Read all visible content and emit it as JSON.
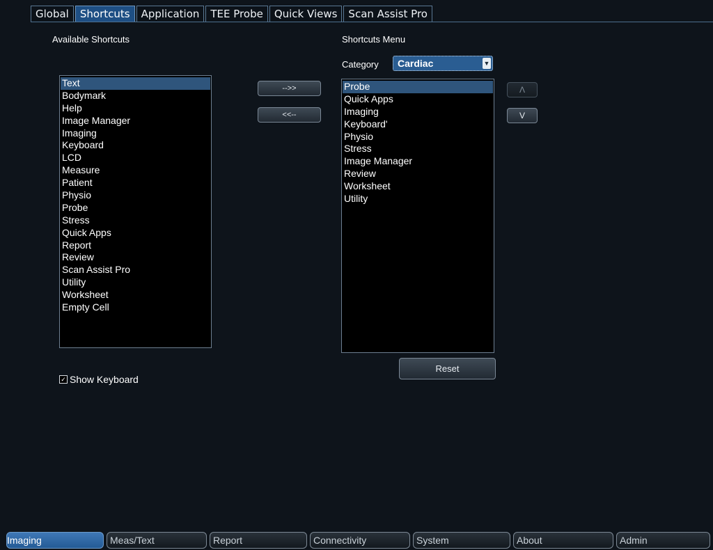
{
  "tabs": [
    "Global",
    "Shortcuts",
    "Application",
    "TEE Probe",
    "Quick Views",
    "Scan Assist Pro"
  ],
  "available": {
    "title": "Available Shortcuts",
    "items": [
      "Text",
      "Bodymark",
      "Help",
      "Image Manager",
      "Imaging",
      "Keyboard",
      "LCD",
      "Measure",
      "Patient",
      "Physio",
      "Probe",
      "Stress",
      "Quick Apps",
      "Report",
      "Review",
      "Scan Assist Pro",
      "Utility",
      "Worksheet",
      "Empty Cell"
    ],
    "selected": "Text"
  },
  "transfer": {
    "add": "-->>",
    "remove": "<<--"
  },
  "menu": {
    "title": "Shortcuts Menu",
    "category_label": "Category",
    "category_value": "Cardiac",
    "items": [
      "Probe",
      "Quick Apps",
      "Imaging",
      "Keyboard'",
      "Physio",
      "Stress",
      "Image Manager",
      "Review",
      "Worksheet",
      "Utility"
    ],
    "selected": "Probe",
    "up": "Λ",
    "down": "V",
    "reset": "Reset"
  },
  "show_keyboard": {
    "label": "Show Keyboard",
    "checked": true
  },
  "bottom_tabs": [
    "Imaging",
    "Meas/Text",
    "Report",
    "Connectivity",
    "System",
    "About",
    "Admin"
  ],
  "colors": {
    "background": "#0e141b",
    "active_tab": "#1e4f84",
    "selection": "#2f557c",
    "bottom_active": "#3472b0"
  }
}
